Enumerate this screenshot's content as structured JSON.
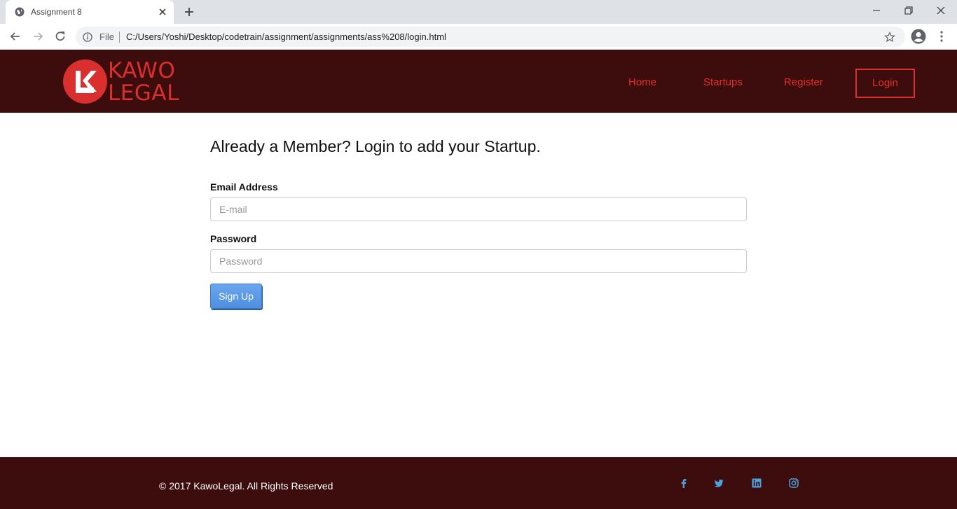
{
  "browser": {
    "tab_title": "Assignment 8",
    "omnibox_scheme_label": "File",
    "url": "C:/Users/Yoshi/Desktop/codetrain/assignment/assignments/ass%208/login.html"
  },
  "header": {
    "logo_mark": "K",
    "logo_line1": "KAWO",
    "logo_line2": "LEGAL",
    "nav": {
      "home": "Home",
      "startups": "Startups",
      "register": "Register",
      "login": "Login"
    },
    "colors": {
      "background": "#3d0d0d",
      "accent": "#d9302f"
    }
  },
  "form": {
    "title": "Already a Member? Login to add your Startup.",
    "email_label": "Email Address",
    "email_placeholder": "E-mail",
    "email_value": "",
    "password_label": "Password",
    "password_placeholder": "Password",
    "password_value": "",
    "submit_label": "Sign Up",
    "submit_color": "#4a90e2"
  },
  "footer": {
    "copyright": "© 2017 KawoLegal. All Rights Reserved",
    "social_icons": [
      "facebook-icon",
      "twitter-icon",
      "linkedin-icon",
      "instagram-icon"
    ],
    "icon_color": "#4aa3df"
  }
}
